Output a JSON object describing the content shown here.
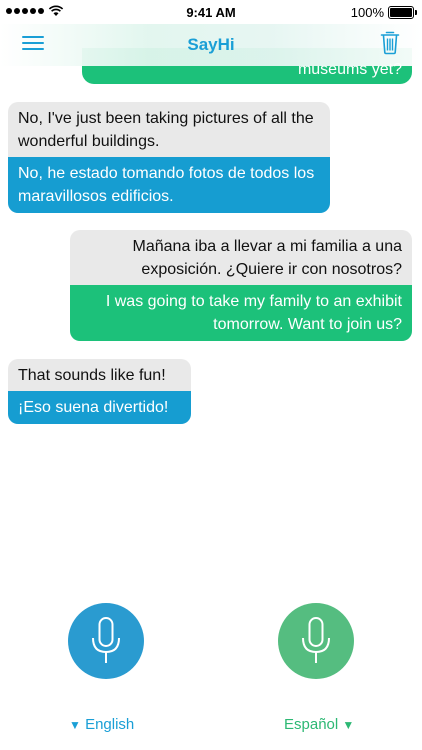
{
  "status_bar": {
    "time": "9:41 AM",
    "battery": "100%"
  },
  "nav": {
    "title": "SayHi",
    "menu_icon": "hamburger-menu-icon",
    "trash_icon": "trash-icon"
  },
  "messages": [
    {
      "side": "right",
      "source": "",
      "translation": "museums yet?"
    },
    {
      "side": "left",
      "source": "No, I've just been taking pictures of all the wonderful buildings.",
      "translation": "No, he estado tomando fotos de todos los maravillosos edificios."
    },
    {
      "side": "right",
      "source": "Mañana iba a llevar a mi familia a una exposición. ¿Quiere ir con nosotros?",
      "translation": "I was going to take my family to an exhibit tomorrow. Want to join us?"
    },
    {
      "side": "left",
      "source": "That sounds like fun!",
      "translation": "¡Eso suena divertido!"
    }
  ],
  "controls": {
    "left_language": "English",
    "right_language": "Español",
    "left_arrow": "▼",
    "right_arrow": "▼",
    "mic_icon": "microphone-icon"
  },
  "colors": {
    "accent_blue": "#169dd1",
    "accent_green": "#1cc17a",
    "bubble_gray": "#e9e9e9"
  }
}
